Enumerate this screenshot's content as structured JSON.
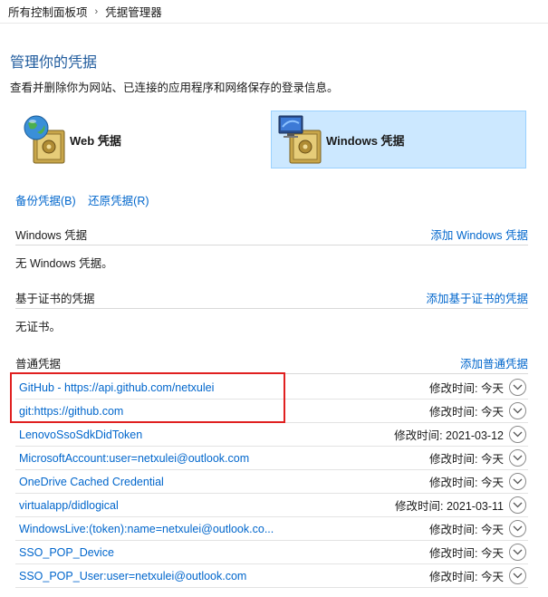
{
  "breadcrumb": {
    "root": "所有控制面板项",
    "current": "凭据管理器"
  },
  "page": {
    "title": "管理你的凭据",
    "subtitle": "查看并删除你为网站、已连接的应用程序和网络保存的登录信息。"
  },
  "vaults": {
    "web_label": "Web 凭据",
    "windows_label": "Windows 凭据"
  },
  "links": {
    "backup": "备份凭据(B)",
    "restore": "还原凭据(R)"
  },
  "sections": {
    "windows": {
      "title": "Windows 凭据",
      "add": "添加 Windows 凭据",
      "empty": "无 Windows 凭据。"
    },
    "certificate": {
      "title": "基于证书的凭据",
      "add": "添加基于证书的凭据",
      "empty": "无证书。"
    },
    "generic": {
      "title": "普通凭据",
      "add": "添加普通凭据"
    }
  },
  "generic_credentials": [
    {
      "name": "GitHub - https://api.github.com/netxulei",
      "modified": "修改时间:  今天"
    },
    {
      "name": "git:https://github.com",
      "modified": "修改时间:  今天"
    },
    {
      "name": "LenovoSsoSdkDidToken",
      "modified": "修改时间:  2021-03-12"
    },
    {
      "name": "MicrosoftAccount:user=netxulei@outlook.com",
      "modified": "修改时间:  今天"
    },
    {
      "name": "OneDrive Cached Credential",
      "modified": "修改时间:  今天"
    },
    {
      "name": "virtualapp/didlogical",
      "modified": "修改时间:  2021-03-11"
    },
    {
      "name": "WindowsLive:(token):name=netxulei@outlook.co...",
      "modified": "修改时间:  今天"
    },
    {
      "name": "SSO_POP_Device",
      "modified": "修改时间:  今天"
    },
    {
      "name": "SSO_POP_User:user=netxulei@outlook.com",
      "modified": "修改时间:  今天"
    }
  ],
  "icons": {
    "breadcrumb_separator": "chevron-right-icon",
    "row_expand": "chevron-down-icon",
    "web_vault": "globe-safe-icon",
    "windows_vault": "monitor-safe-icon"
  },
  "colors": {
    "accent": "#0066cc",
    "title": "#1e5a9c",
    "selected_tile": "#cce8ff",
    "highlight": "#e02020"
  }
}
